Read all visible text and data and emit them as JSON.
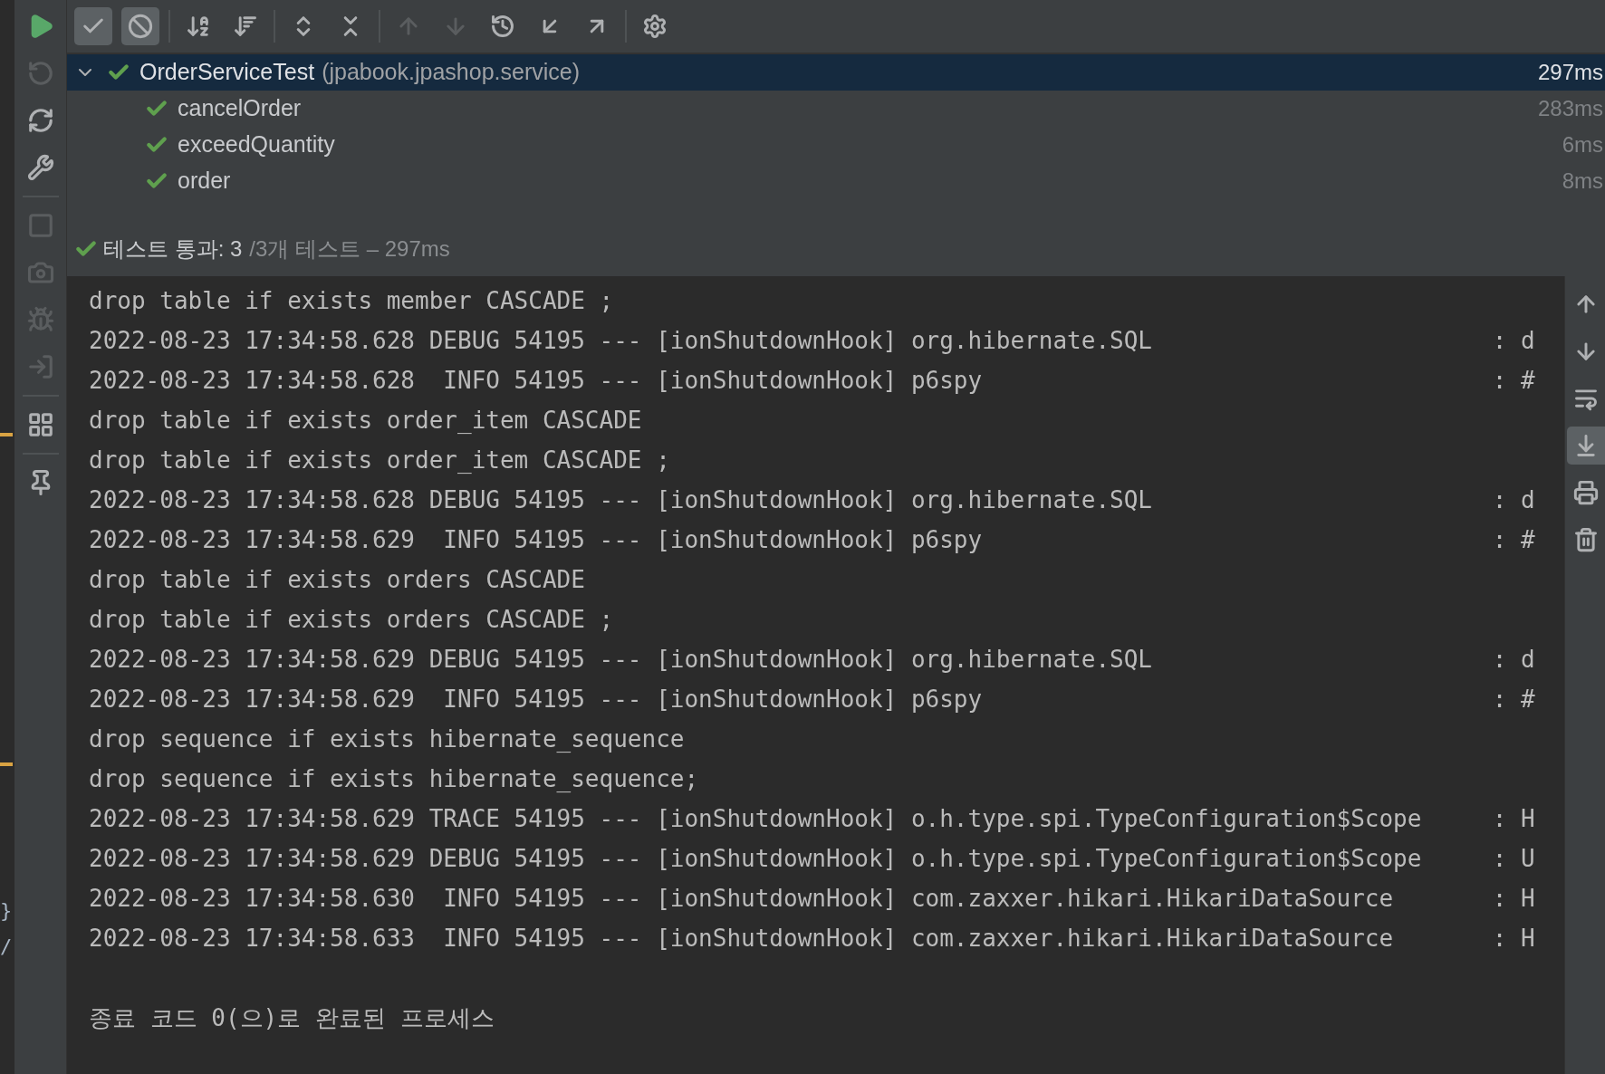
{
  "editor_gutter": {
    "glyphs": [
      "}",
      "/"
    ]
  },
  "side_toolbar": [
    {
      "kind": "run",
      "disabled": false
    },
    {
      "kind": "rerun-failed",
      "disabled": true
    },
    {
      "kind": "auto-test",
      "disabled": false
    },
    {
      "kind": "settings",
      "disabled": false
    },
    {
      "kind": "divider"
    },
    {
      "kind": "stop",
      "disabled": true
    },
    {
      "kind": "snapshot",
      "disabled": true
    },
    {
      "kind": "debug",
      "disabled": true
    },
    {
      "kind": "import",
      "disabled": true
    },
    {
      "kind": "divider"
    },
    {
      "kind": "layout",
      "disabled": false
    },
    {
      "kind": "divider"
    },
    {
      "kind": "pin",
      "disabled": false
    }
  ],
  "toolbar": [
    {
      "kind": "show-passed",
      "on": true,
      "disabled": false
    },
    {
      "kind": "show-ignored",
      "on": true,
      "disabled": false
    },
    {
      "kind": "divider"
    },
    {
      "kind": "sort-alpha",
      "on": false,
      "disabled": false
    },
    {
      "kind": "sort-duration",
      "on": false,
      "disabled": false
    },
    {
      "kind": "divider"
    },
    {
      "kind": "expand-all",
      "on": false,
      "disabled": false
    },
    {
      "kind": "collapse-all",
      "on": false,
      "disabled": false
    },
    {
      "kind": "divider"
    },
    {
      "kind": "previous",
      "on": false,
      "disabled": true
    },
    {
      "kind": "next",
      "on": false,
      "disabled": true
    },
    {
      "kind": "history",
      "on": false,
      "disabled": false
    },
    {
      "kind": "import-results",
      "on": false,
      "disabled": false
    },
    {
      "kind": "export-results",
      "on": false,
      "disabled": false
    },
    {
      "kind": "divider"
    },
    {
      "kind": "options",
      "on": false,
      "disabled": false
    }
  ],
  "test_tree": {
    "name": "OrderServiceTest",
    "package": "(jpabook.jpashop.service)",
    "time": "297ms",
    "passed": true,
    "expanded": true,
    "selected": true,
    "children": [
      {
        "name": "cancelOrder",
        "time": "283ms",
        "passed": true,
        "selected": false
      },
      {
        "name": "exceedQuantity",
        "time": "6ms",
        "passed": true,
        "selected": false
      },
      {
        "name": "order",
        "time": "8ms",
        "passed": true,
        "selected": false
      }
    ]
  },
  "summary": {
    "passed": true,
    "label": "테스트 통과: 3",
    "detail": "/3개 테스트 – 297ms"
  },
  "console": {
    "lines": [
      "drop table if exists member CASCADE ;",
      "2022-08-23 17:34:58.628 DEBUG 54195 --- [ionShutdownHook] org.hibernate.SQL                        : d",
      "2022-08-23 17:34:58.628  INFO 54195 --- [ionShutdownHook] p6spy                                    : #",
      "drop table if exists order_item CASCADE",
      "drop table if exists order_item CASCADE ;",
      "2022-08-23 17:34:58.628 DEBUG 54195 --- [ionShutdownHook] org.hibernate.SQL                        : d",
      "2022-08-23 17:34:58.629  INFO 54195 --- [ionShutdownHook] p6spy                                    : #",
      "drop table if exists orders CASCADE",
      "drop table if exists orders CASCADE ;",
      "2022-08-23 17:34:58.629 DEBUG 54195 --- [ionShutdownHook] org.hibernate.SQL                        : d",
      "2022-08-23 17:34:58.629  INFO 54195 --- [ionShutdownHook] p6spy                                    : #",
      "drop sequence if exists hibernate_sequence",
      "drop sequence if exists hibernate_sequence;",
      "2022-08-23 17:34:58.629 TRACE 54195 --- [ionShutdownHook] o.h.type.spi.TypeConfiguration$Scope     : H",
      "2022-08-23 17:34:58.629 DEBUG 54195 --- [ionShutdownHook] o.h.type.spi.TypeConfiguration$Scope     : U",
      "2022-08-23 17:34:58.630  INFO 54195 --- [ionShutdownHook] com.zaxxer.hikari.HikariDataSource       : H",
      "2022-08-23 17:34:58.633  INFO 54195 --- [ionShutdownHook] com.zaxxer.hikari.HikariDataSource       : H"
    ],
    "exit_message": "종료 코드 0(으)로 완료된 프로세스"
  },
  "console_toolbar": [
    {
      "kind": "up",
      "on": false
    },
    {
      "kind": "down",
      "on": false
    },
    {
      "kind": "soft-wrap",
      "on": false
    },
    {
      "kind": "scroll-to-end",
      "on": true
    },
    {
      "kind": "print",
      "on": false
    },
    {
      "kind": "clear",
      "on": false
    }
  ]
}
